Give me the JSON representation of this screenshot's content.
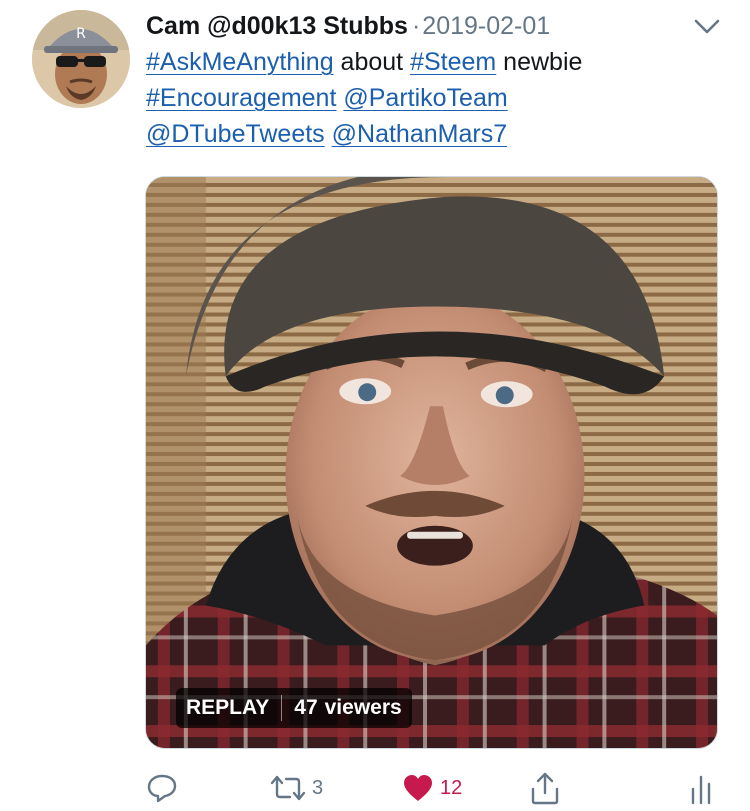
{
  "tweet": {
    "display_name": "Cam @d00k13 Stubbs",
    "separator": "·",
    "date": "2019-02-01",
    "body": {
      "tokens": [
        {
          "text": "#AskMeAnything",
          "link": true
        },
        {
          "text": " about ",
          "link": false
        },
        {
          "text": "#Steem",
          "link": true
        },
        {
          "text": " newbie ",
          "link": false
        },
        {
          "text": "#Encouragement",
          "link": true
        },
        {
          "text": " ",
          "link": false
        },
        {
          "text": "@PartikoTeam",
          "link": true
        },
        {
          "text": " ",
          "link": false
        },
        {
          "text": "@DTubeTweets",
          "link": true
        },
        {
          "text": " ",
          "link": false
        },
        {
          "text": "@NathanMars7",
          "link": true
        }
      ]
    },
    "media": {
      "replay_label": "REPLAY",
      "viewers_count": "47",
      "viewers_label": "viewers"
    },
    "actions": {
      "reply_count": "",
      "retweet_count": "3",
      "like_count": "12"
    },
    "icons": {
      "reply": "reply-icon",
      "retweet": "retweet-icon",
      "like": "heart-icon",
      "share": "share-icon",
      "analytics": "analytics-icon",
      "menu": "chevron-down-icon"
    },
    "colors": {
      "link": "#1b5fae",
      "muted": "#657786",
      "like": "#c6194d"
    }
  }
}
